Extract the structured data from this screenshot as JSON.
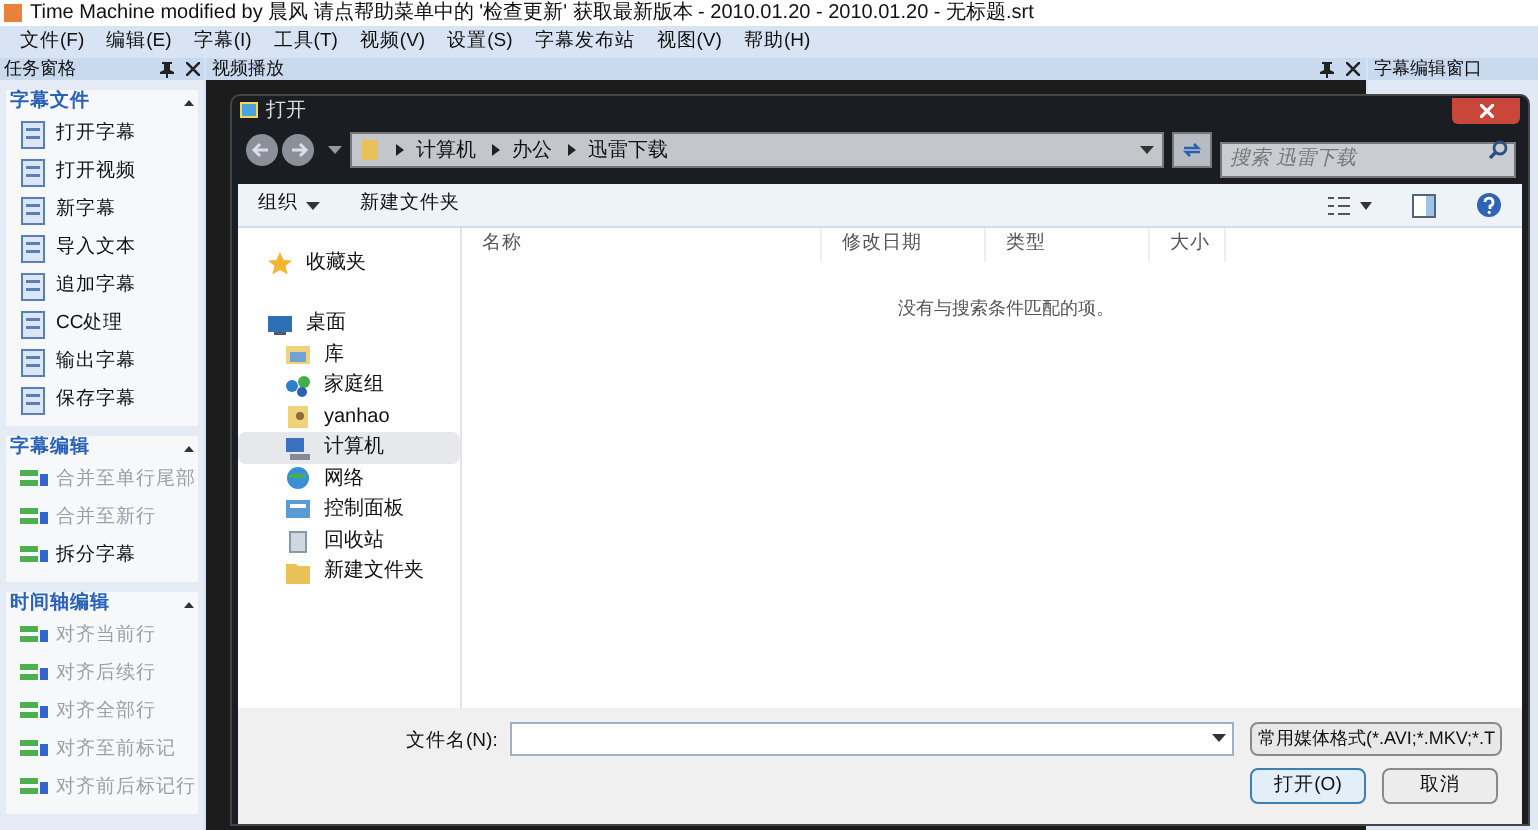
{
  "window": {
    "title": "Time Machine modified by 晨风 请点帮助菜单中的 '检查更新' 获取最新版本 - 2010.01.20 - 2010.01.20 - 无标题.srt"
  },
  "menu": [
    "文件(F)",
    "编辑(E)",
    "字幕(I)",
    "工具(T)",
    "视频(V)",
    "设置(S)",
    "字幕发布站",
    "视图(V)",
    "帮助(H)"
  ],
  "task_pane": {
    "title": "任务窗格",
    "groups": [
      {
        "title": "字幕文件",
        "expanded": true,
        "items": [
          {
            "label": "打开字幕",
            "disabled": false
          },
          {
            "label": "打开视频",
            "disabled": false
          },
          {
            "label": "新字幕",
            "disabled": false
          },
          {
            "label": "导入文本",
            "disabled": false
          },
          {
            "label": "追加字幕",
            "disabled": false
          },
          {
            "label": "CC处理",
            "disabled": false
          },
          {
            "label": "输出字幕",
            "disabled": false
          },
          {
            "label": "保存字幕",
            "disabled": false
          }
        ]
      },
      {
        "title": "字幕编辑",
        "expanded": true,
        "items": [
          {
            "label": "合并至单行尾部",
            "disabled": true
          },
          {
            "label": "合并至新行",
            "disabled": true
          },
          {
            "label": "拆分字幕",
            "disabled": false
          }
        ]
      },
      {
        "title": "时间轴编辑",
        "expanded": true,
        "items": [
          {
            "label": "对齐当前行",
            "disabled": true
          },
          {
            "label": "对齐后续行",
            "disabled": true
          },
          {
            "label": "对齐全部行",
            "disabled": true
          },
          {
            "label": "对齐至前标记",
            "disabled": true
          },
          {
            "label": "对齐前后标记行",
            "disabled": true
          }
        ]
      }
    ]
  },
  "video_panel": {
    "title": "视频播放"
  },
  "subtitle_panel": {
    "title": "字幕编辑窗口"
  },
  "dialog": {
    "title": "打开",
    "breadcrumb": [
      "计算机",
      "办公",
      "迅雷下载"
    ],
    "search": {
      "placeholder": "搜索 迅雷下载"
    },
    "toolbar": [
      {
        "label": "组织",
        "has_menu": true
      },
      {
        "label": "新建文件夹",
        "has_menu": false
      }
    ],
    "nav": [
      {
        "label": "收藏夹",
        "kind": "star",
        "selected": false
      },
      {
        "label": "桌面",
        "kind": "desktop",
        "selected": false,
        "children": [
          {
            "label": "库",
            "kind": "library",
            "selected": false
          },
          {
            "label": "家庭组",
            "kind": "homegroup",
            "selected": false
          },
          {
            "label": "yanhao",
            "kind": "user",
            "selected": false
          },
          {
            "label": "计算机",
            "kind": "computer",
            "selected": true
          },
          {
            "label": "网络",
            "kind": "network",
            "selected": false
          },
          {
            "label": "控制面板",
            "kind": "control",
            "selected": false
          },
          {
            "label": "回收站",
            "kind": "bin",
            "selected": false
          },
          {
            "label": "新建文件夹",
            "kind": "folder",
            "selected": false
          }
        ]
      }
    ],
    "columns": [
      "名称",
      "修改日期",
      "类型",
      "大小"
    ],
    "empty_message": "没有与搜索条件匹配的项。",
    "filename": {
      "label": "文件名(N):"
    },
    "filter": "常用媒体格式(*.AVI;*.MKV;*.T",
    "buttons": [
      "打开(O)",
      "取消"
    ]
  }
}
